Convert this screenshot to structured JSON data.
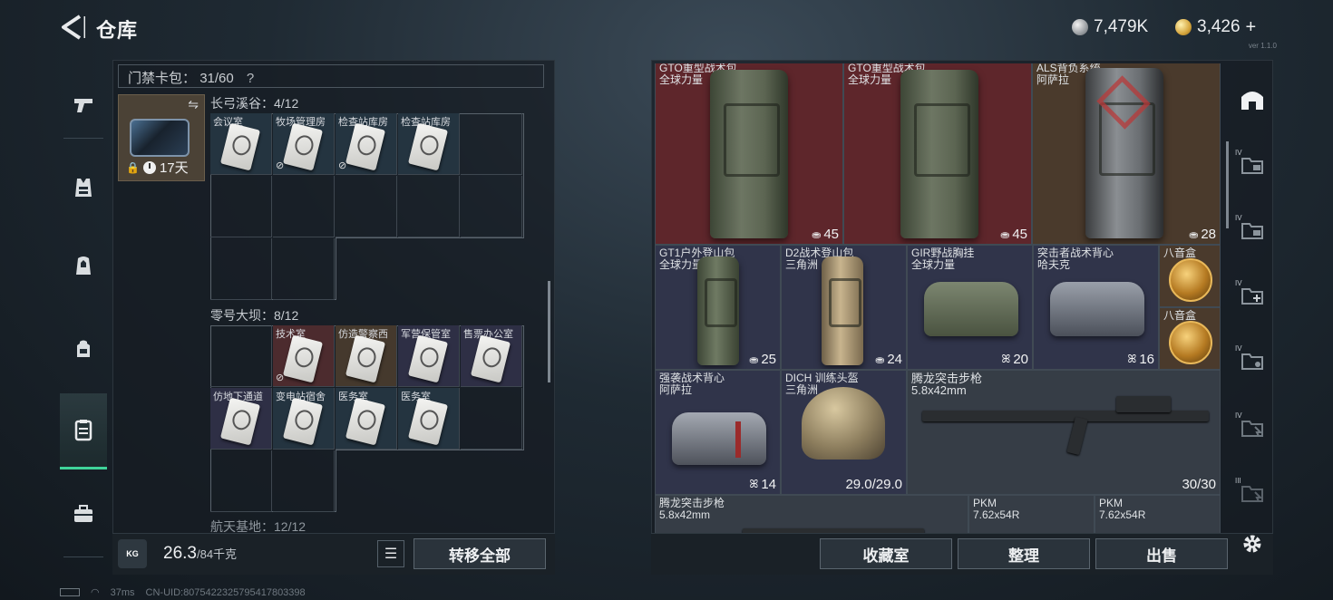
{
  "header": {
    "title": "仓库",
    "currency": [
      {
        "icon": "silver-coin-icon",
        "value": "7,479K"
      },
      {
        "icon": "gold-coin-icon",
        "value": "3,426",
        "add": "+"
      }
    ],
    "version": "ver 1.1.0"
  },
  "left_nav": {
    "items": [
      {
        "icon": "pistol-icon"
      },
      {
        "icon": "vest-icon"
      },
      {
        "icon": "backpack-armor-icon"
      },
      {
        "icon": "backpack-icon"
      },
      {
        "icon": "keycard-case-icon",
        "active": true
      },
      {
        "icon": "briefcase-icon"
      }
    ]
  },
  "keycard": {
    "label": "门禁卡包：",
    "capacity": "31/60",
    "help": "?",
    "swap_icon": "⇋",
    "duration": "17天"
  },
  "sections": [
    {
      "title": "长弓溪谷：",
      "count": "4/12",
      "slots": [
        "会议室",
        "牧场管理房",
        "检查站库房",
        "检查站库房"
      ]
    },
    {
      "title": "零号大坝：",
      "count": "8/12",
      "slots": [
        "技术室",
        "仿造警察西",
        "军营保管室",
        "售票办公室",
        "仿地下通道",
        "变电站宿舍",
        "医务室",
        "医务室"
      ]
    },
    {
      "title": "航天基地：",
      "count": "12/12"
    }
  ],
  "bottom_left": {
    "weight_icon": "KG",
    "weight": "26.3",
    "weight_max": "/84千克",
    "list_icon": "☰",
    "transfer_all": "转移全部"
  },
  "items": [
    {
      "name": "GTO重型战术包",
      "sub": "全球力量",
      "count": "45"
    },
    {
      "name": "GTO重型战术包",
      "sub": "全球力量",
      "count": "45"
    },
    {
      "name": "ALS背负系统",
      "sub": "阿萨拉",
      "count": "28"
    },
    {
      "name": "GT1户外登山包",
      "sub": "全球力量",
      "count": "25"
    },
    {
      "name": "D2战术登山包",
      "sub": "三角洲",
      "count": "24"
    },
    {
      "name": "GIR野战胸挂",
      "sub": "全球力量",
      "count": "20"
    },
    {
      "name": "突击者战术背心",
      "sub": "哈夫克",
      "count": "16"
    },
    {
      "name": "八音盒",
      "sub": "",
      "count": ""
    },
    {
      "name": "八音盒",
      "sub": "",
      "count": ""
    },
    {
      "name": "强袭战术背心",
      "sub": "阿萨拉",
      "count": "14"
    },
    {
      "name": "DICH 训练头盔",
      "sub": "三角洲",
      "count": "29.0/29.0"
    },
    {
      "name": "腾龙突击步枪",
      "sub": "5.8x42mm",
      "count": "30/30"
    },
    {
      "name": "腾龙突击步枪",
      "sub": "5.8x42mm",
      "count": ""
    },
    {
      "name": "PKM",
      "sub": "7.62x54R",
      "count": ""
    },
    {
      "name": "PKM",
      "sub": "7.62x54R",
      "count": ""
    }
  ],
  "bottom_right": {
    "collection": "收藏室",
    "sort": "整理",
    "sell": "出售"
  },
  "right_nav": {
    "items": [
      {
        "icon": "safehouse-icon",
        "tag": ""
      },
      {
        "icon": "folder-iv-icon",
        "tag": "IV"
      },
      {
        "icon": "folder-iv-icon",
        "tag": "IV"
      },
      {
        "icon": "folder-add-icon",
        "tag": "IV"
      },
      {
        "icon": "folder-settings-icon",
        "tag": "IV"
      },
      {
        "icon": "folder-cursor-icon",
        "tag": "IV"
      },
      {
        "icon": "folder-cursor-icon",
        "tag": "III"
      }
    ],
    "settings_icon": "gear-icon"
  },
  "status": {
    "signal": "37ms",
    "user_id": "CN-UID:8075422325795417803398"
  }
}
